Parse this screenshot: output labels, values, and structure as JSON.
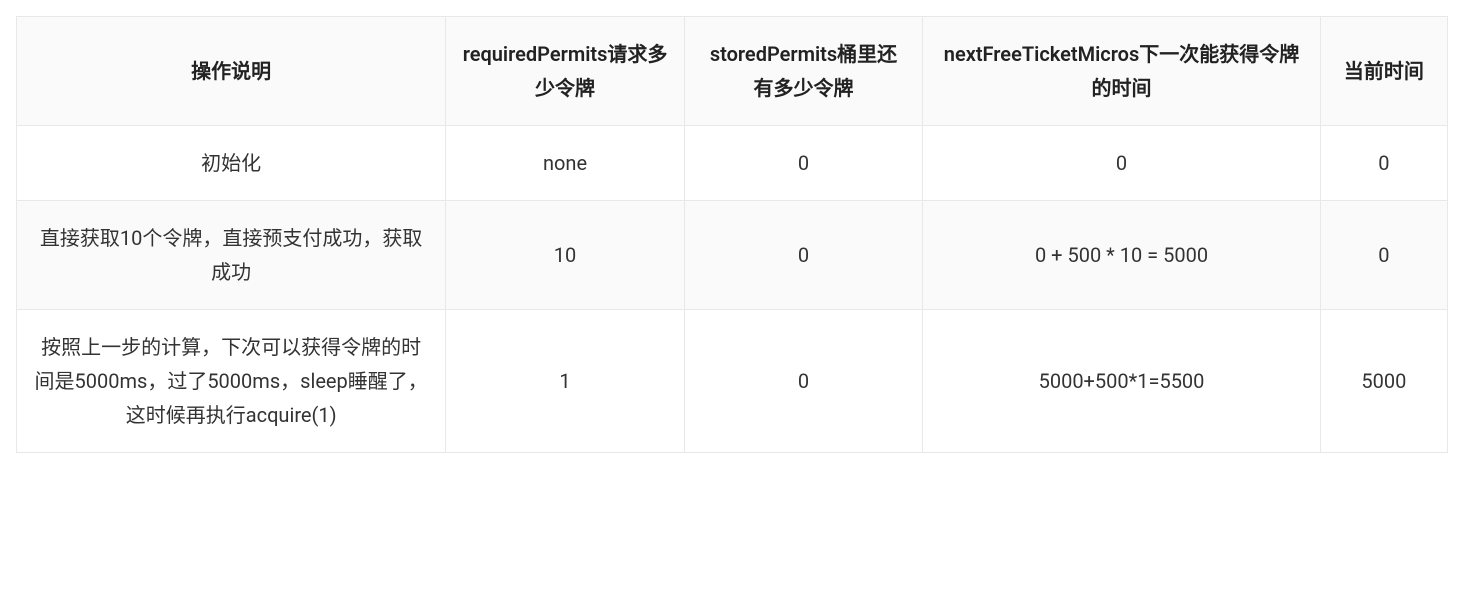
{
  "chart_data": {
    "type": "table",
    "headers": [
      "操作说明",
      "requiredPermits请求多少令牌",
      "storedPermits桶里还有多少令牌",
      "nextFreeTicketMicros下一次能获得令牌的时间",
      "当前时间"
    ],
    "rows": [
      [
        "初始化",
        "none",
        "0",
        "0",
        "0"
      ],
      [
        "直接获取10个令牌，直接预支付成功，获取成功",
        "10",
        "0",
        "0 + 500 * 10 = 5000",
        "0"
      ],
      [
        "按照上一步的计算，下次可以获得令牌的时间是5000ms，过了5000ms，sleep睡醒了，这时候再执行acquire(1)",
        "1",
        "0",
        "5000+500*1=5500",
        "5000"
      ]
    ]
  }
}
